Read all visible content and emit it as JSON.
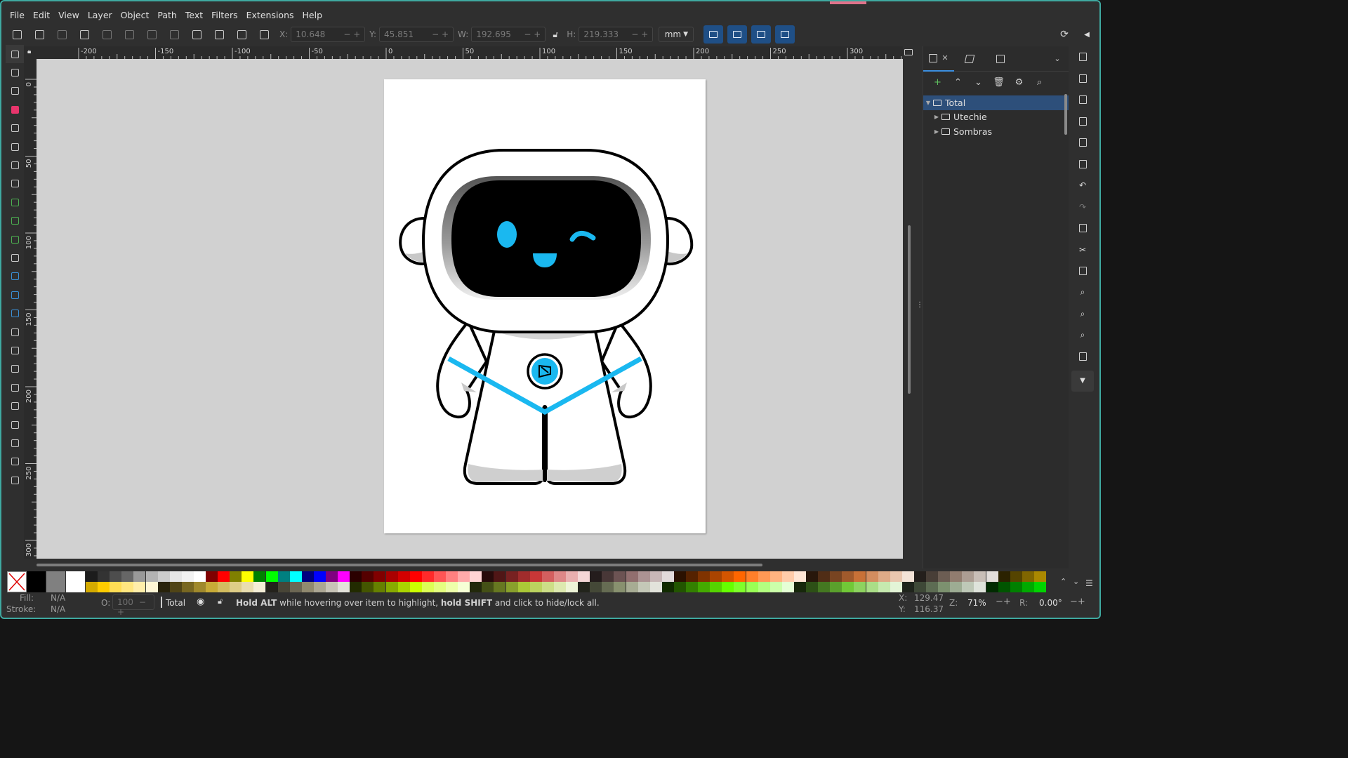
{
  "menu": [
    "File",
    "Edit",
    "View",
    "Layer",
    "Object",
    "Path",
    "Text",
    "Filters",
    "Extensions",
    "Help"
  ],
  "toolcontrols": {
    "x_label": "X:",
    "x_value": "10.648",
    "y_label": "Y:",
    "y_value": "45.851",
    "w_label": "W:",
    "w_value": "192.695",
    "h_label": "H:",
    "h_value": "219.333",
    "unit": "mm"
  },
  "ruler": {
    "h_ticks": [
      "-200",
      "-150",
      "-100",
      "-50",
      "0",
      "50",
      "100",
      "150",
      "200",
      "250",
      "300"
    ],
    "v_ticks": [
      "0",
      "50",
      "100",
      "150",
      "200",
      "250",
      "300"
    ]
  },
  "tools": [
    "selector-tool",
    "node-tool",
    "tweak-tool",
    "rectangle-tool",
    "ellipse-tool",
    "star-tool",
    "3d-box-tool",
    "spiral-tool",
    "pen-tool",
    "pencil-tool",
    "calligraphy-tool",
    "text-tool",
    "gradient-tool",
    "mesh-tool",
    "dropper-tool",
    "paint-bucket-tool",
    "tweak-brush-tool",
    "spray-tool",
    "eraser-tool",
    "connector-tool",
    "measure-text-tool",
    "pages-tool",
    "zoom-tool",
    "clone-tool"
  ],
  "layers": {
    "items": [
      {
        "name": "Total",
        "expanded": true,
        "selected": true
      },
      {
        "name": "Utechie",
        "expanded": false,
        "selected": false
      },
      {
        "name": "Sombras",
        "expanded": false,
        "selected": false
      }
    ]
  },
  "status": {
    "fill_label": "Fill:",
    "fill_value": "N/A",
    "stroke_label": "Stroke:",
    "stroke_value": "N/A",
    "opacity_label": "O:",
    "opacity_value": "100",
    "layer_name": "Total",
    "msg_1": "Hold ALT",
    "msg_2": " while hovering over item to highlight, ",
    "msg_3": "hold SHIFT",
    "msg_4": " and click to hide/lock all.",
    "cx_label": "X:",
    "cx_value": "129.47",
    "cy_label": "Y:",
    "cy_value": "116.37",
    "zoom_label": "Z:",
    "zoom_value": "71%",
    "rot_label": "R:",
    "rot_value": "0.00°"
  },
  "colors": {
    "accent": "#1f4f86",
    "robot_blue": "#1ab8f0",
    "selection": "#2d4f7a",
    "window_border": "#3fa9a0"
  },
  "palette_row1": [
    "#000000",
    "#808080",
    "#ffffff",
    "#1c1c1c",
    "#333333",
    "#4d4d4d",
    "#666666",
    "#999999",
    "#b3b3b3",
    "#cccccc",
    "#e6e6e6",
    "#f2f2f2",
    "#ffffff",
    "#800000",
    "#ff0000",
    "#808000",
    "#ffff00",
    "#008000",
    "#00ff00",
    "#008080",
    "#00ffff",
    "#000080",
    "#0000ff",
    "#800080",
    "#ff00ff",
    "#2b0000",
    "#550000",
    "#800000",
    "#aa0000",
    "#d40000",
    "#ff0000",
    "#ff2a2a",
    "#ff5555",
    "#ff8080",
    "#ffaaaa",
    "#ffd5d5",
    "#280b0b",
    "#501616",
    "#782121",
    "#a02c2c",
    "#c83737",
    "#d35f5f",
    "#de8787",
    "#e9afaf",
    "#f4d7d7",
    "#241c1c",
    "#483737",
    "#6c5353",
    "#916f6f",
    "#ac9393",
    "#c8b7b7",
    "#e3dbdb",
    "#2b1100",
    "#552200",
    "#803300",
    "#aa4400",
    "#d45500",
    "#ff6600",
    "#ff7f2a",
    "#ff9955",
    "#ffb380",
    "#ffccaa",
    "#ffe6d5",
    "#28170b",
    "#502d16",
    "#784421",
    "#a05a2c",
    "#c87137",
    "#d38d5f",
    "#deaa87",
    "#e9c6af",
    "#f4e3d7",
    "#241f1c",
    "#483e37",
    "#6c5d53",
    "#917c6f",
    "#ac9d93",
    "#c8beb7",
    "#e3dedb",
    "#2b2200",
    "#554400",
    "#806600",
    "#aa8800"
  ],
  "palette_row2": [
    "#d4aa00",
    "#ffcc00",
    "#ffdd55",
    "#ffe680",
    "#ffeeaa",
    "#fff6d5",
    "#28220b",
    "#504416",
    "#786721",
    "#a0892c",
    "#c8ab37",
    "#d3bc5f",
    "#decd87",
    "#e9ddaf",
    "#f4eed7",
    "#24221c",
    "#484537",
    "#6c6753",
    "#918a6f",
    "#aca793",
    "#c8c4b7",
    "#e3e2db",
    "#222b00",
    "#445500",
    "#668000",
    "#88aa00",
    "#aad400",
    "#ccff00",
    "#ddff55",
    "#e5ff80",
    "#eeffaa",
    "#f6ffd5",
    "#22280b",
    "#445016",
    "#677821",
    "#89a02c",
    "#abc837",
    "#bcd35f",
    "#cdde87",
    "#dde9af",
    "#eef4d7",
    "#22241c",
    "#444837",
    "#666c53",
    "#88916f",
    "#a7ac93",
    "#c4c8b7",
    "#e2e3db",
    "#112b00",
    "#225500",
    "#338000",
    "#44aa00",
    "#55d400",
    "#66ff00",
    "#7fff2a",
    "#99ff55",
    "#b3ff80",
    "#ccffaa",
    "#e5ffd5",
    "#17280b",
    "#2d5016",
    "#447821",
    "#5aa02c",
    "#71c837",
    "#8dd35f",
    "#aade87",
    "#c6e9af",
    "#e3f4d7",
    "#1f241c",
    "#3e4837",
    "#5d6c53",
    "#7c916f",
    "#9dac93",
    "#bec8b7",
    "#dee3db",
    "#002b00",
    "#005500",
    "#008000",
    "#00aa00",
    "#00d400"
  ]
}
